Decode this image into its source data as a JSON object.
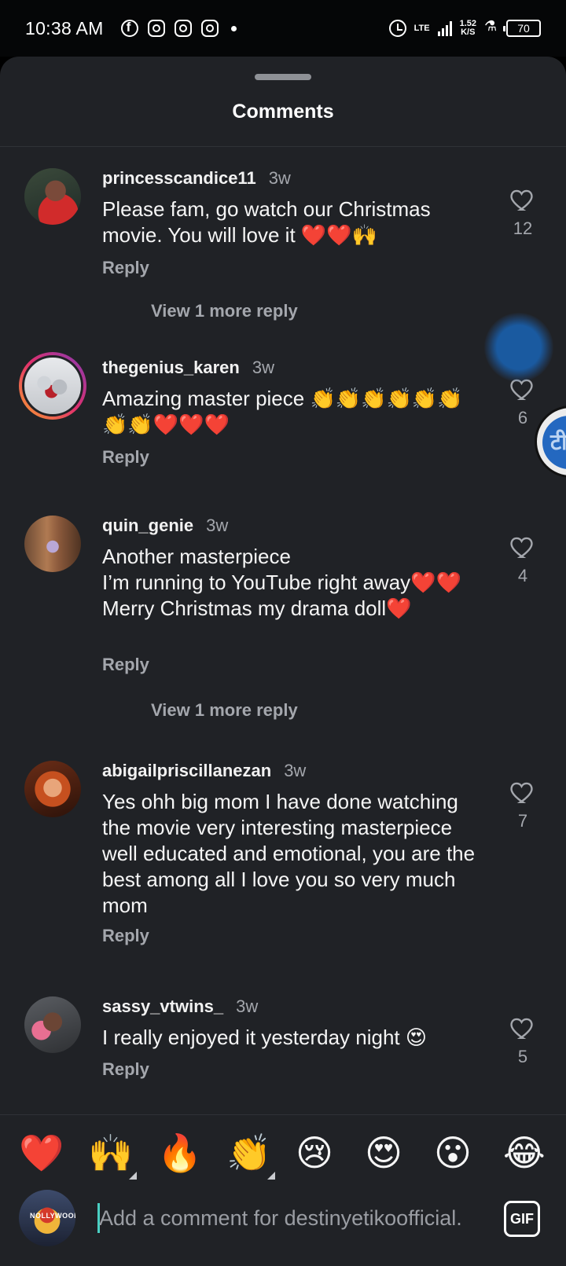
{
  "status_bar": {
    "time": "10:38 AM",
    "network": "LTE",
    "speed_value": "1.52",
    "speed_unit": "K/S",
    "battery": "70"
  },
  "sheet": {
    "title": "Comments"
  },
  "comments": [
    {
      "username": "princesscandice11",
      "time": "3w",
      "text": "Please fam, go watch our Christmas movie. You will love it ❤️❤️🙌",
      "likes": "12",
      "reply_label": "Reply",
      "view_replies": "View 1 more reply"
    },
    {
      "username": "thegenius_karen",
      "time": "3w",
      "text": "Amazing master piece 👏👏👏👏👏👏👏👏❤️❤️❤️",
      "likes": "6",
      "reply_label": "Reply"
    },
    {
      "username": "quin_genie",
      "time": "3w",
      "text": "Another masterpiece\nI’m running to YouTube right away❤️❤️\nMerry Christmas my drama doll❤️",
      "likes": "4",
      "reply_label": "Reply",
      "view_replies": "View 1 more reply"
    },
    {
      "username": "abigailpriscillanezan",
      "time": "3w",
      "text": "Yes ohh big mom I have done watching the movie very interesting masterpiece well educated and emotional, you are the best among all I love you so very much mom",
      "likes": "7",
      "reply_label": "Reply"
    },
    {
      "username": "sassy_vtwins_",
      "time": "3w",
      "text": "I really enjoyed it yesterday night 😍",
      "likes": "5",
      "reply_label": "Reply"
    }
  ],
  "side_widget": {
    "glyph": "टी"
  },
  "emoji_bar": [
    "❤️",
    "🙌",
    "🔥",
    "👏",
    "😢",
    "😍",
    "😮",
    "😂"
  ],
  "composer": {
    "avatar_text": "NOLLYWOOD",
    "placeholder": "Add a comment for destinyetikoofficial.",
    "gif_label": "GIF"
  },
  "colors": {
    "sheet_background": "#202226",
    "secondary_text": "#a4a7ad",
    "caret": "#4ad0c3"
  }
}
